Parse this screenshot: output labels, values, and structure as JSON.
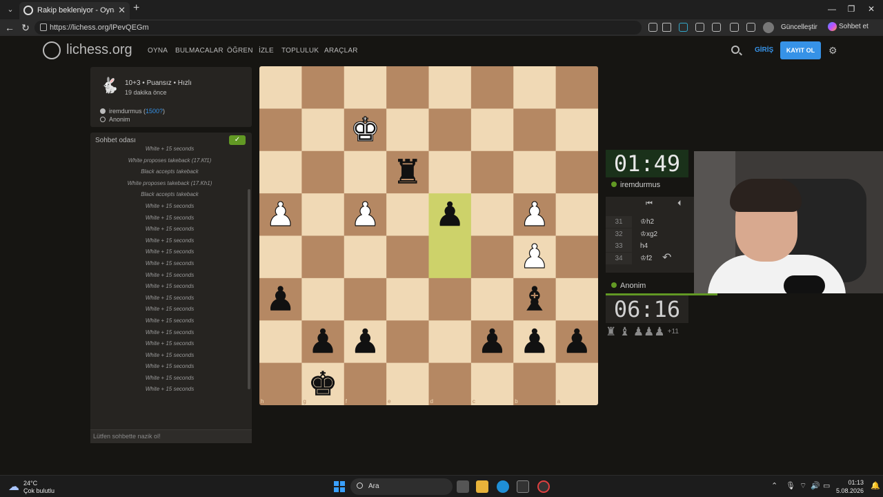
{
  "browser": {
    "tab_title": "Rakip bekleniyor - Oyna iremdurmus",
    "url": "https://lichess.org/lPevQEGm",
    "update_label": "Güncelleştir",
    "chat_label": "Sohbet et"
  },
  "site": {
    "logo_text": "lichess.org",
    "nav": [
      "OYNA",
      "BULMACALAR",
      "ÖĞREN",
      "İZLE",
      "TOPLULUK",
      "ARAÇLAR"
    ],
    "login_label": "GİRİŞ",
    "register_label": "KAYIT OL"
  },
  "game_info": {
    "mode": "10+3 • Puansız • Hızlı",
    "time_ago": "19 dakika önce",
    "white_player": "iremdurmus",
    "white_rating": "1500?",
    "black_player": "Anonim"
  },
  "chat": {
    "title": "Sohbet odası",
    "placeholder": "Lütfen sohbette nazik ol!",
    "lines": [
      "White + 15 seconds",
      "White proposes takeback (17.Kf1)",
      "Black accepts takeback",
      "White proposes takeback (17.Kh1)",
      "Black accepts takeback",
      "White + 15 seconds",
      "White + 15 seconds",
      "White + 15 seconds",
      "White + 15 seconds",
      "White + 15 seconds",
      "White + 15 seconds",
      "White + 15 seconds",
      "White + 15 seconds",
      "White + 15 seconds",
      "White + 15 seconds",
      "White + 15 seconds",
      "White + 15 seconds",
      "White + 15 seconds",
      "White + 15 seconds",
      "White + 15 seconds",
      "White + 15 seconds",
      "White + 15 seconds"
    ]
  },
  "board": {
    "orientation": "black",
    "rank_labels": [
      "1",
      "2",
      "3",
      "4",
      "5",
      "6",
      "7",
      "8"
    ],
    "file_labels": [
      "h",
      "g",
      "f",
      "e",
      "d",
      "c",
      "b",
      "a"
    ],
    "last_move": [
      "d5",
      "d4"
    ],
    "light_color": "#f0d9b5",
    "dark_color": "#b58863",
    "highlight_color": "#cdd26a",
    "pieces": [
      {
        "square": "f2",
        "piece": "wK"
      },
      {
        "square": "e3",
        "piece": "bR"
      },
      {
        "square": "h4",
        "piece": "wP"
      },
      {
        "square": "f4",
        "piece": "wP"
      },
      {
        "square": "d4",
        "piece": "bP"
      },
      {
        "square": "b4",
        "piece": "wP"
      },
      {
        "square": "b5",
        "piece": "wP"
      },
      {
        "square": "h6",
        "piece": "bP"
      },
      {
        "square": "b6",
        "piece": "bB"
      },
      {
        "square": "g7",
        "piece": "bP"
      },
      {
        "square": "f7",
        "piece": "bP"
      },
      {
        "square": "c7",
        "piece": "bP"
      },
      {
        "square": "b7",
        "piece": "bP"
      },
      {
        "square": "a7",
        "piece": "bP"
      },
      {
        "square": "g8",
        "piece": "bK"
      }
    ]
  },
  "clocks": {
    "top": {
      "minutes": "01",
      "seconds": "49",
      "player": "iremdurmus"
    },
    "bottom": {
      "minutes": "06",
      "seconds": "16",
      "player": "Anonim"
    }
  },
  "moves": [
    {
      "num": "31",
      "san": "♔h2"
    },
    {
      "num": "32",
      "san": "♔xg2"
    },
    {
      "num": "33",
      "san": "h4"
    },
    {
      "num": "34",
      "san": "♔f2"
    }
  ],
  "captured": {
    "pieces": "♜ ♝ ♟♟♟",
    "advantage": "+11"
  },
  "taskbar": {
    "temp": "24°C",
    "weather": "Çok bulutlu",
    "search": "Ara",
    "time": "01:13",
    "date": "5.08.2026"
  }
}
